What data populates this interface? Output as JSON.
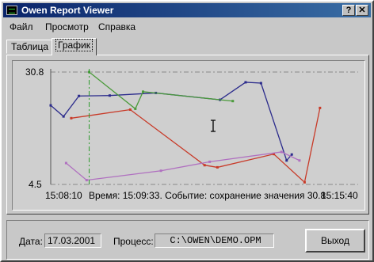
{
  "window": {
    "title": "Owen Report Viewer",
    "help_glyph": "?",
    "close_glyph": "✕"
  },
  "menu": [
    "Файл",
    "Просмотр",
    "Справка"
  ],
  "tabs": [
    {
      "label": "Таблица",
      "active": false
    },
    {
      "label": "График",
      "active": true
    }
  ],
  "chart": {
    "y_top_label": "30.8",
    "y_bottom_label": "4.5",
    "x_start_label": "15:08:10",
    "x_end_label": "15:15:40",
    "status_text": "Время: 15:09:33. Событие: сохранение значения 30.8"
  },
  "chart_data": {
    "type": "line",
    "x_range": [
      "15:08:10",
      "15:15:40"
    ],
    "ylim": [
      4.5,
      30.8
    ],
    "cursor": {
      "x": "15:09:33",
      "y": 30.8
    },
    "series": [
      {
        "color": "#2b2b8c",
        "points": [
          [
            0.0,
            23.0
          ],
          [
            0.05,
            20.4
          ],
          [
            0.11,
            25.2
          ],
          [
            0.23,
            25.3
          ],
          [
            0.41,
            25.9
          ],
          [
            0.66,
            24.3
          ],
          [
            0.76,
            28.4
          ],
          [
            0.82,
            28.2
          ],
          [
            0.92,
            10.1
          ],
          [
            0.94,
            11.5
          ]
        ]
      },
      {
        "color": "#4a9a3a",
        "points": [
          [
            0.15,
            30.8
          ],
          [
            0.33,
            22.2
          ],
          [
            0.36,
            26.2
          ],
          [
            0.71,
            24.0
          ]
        ]
      },
      {
        "color": "#c83a28",
        "points": [
          [
            0.08,
            20.0
          ],
          [
            0.31,
            22.0
          ],
          [
            0.6,
            9.0
          ],
          [
            0.65,
            8.5
          ],
          [
            0.87,
            11.6
          ],
          [
            0.99,
            5.0
          ],
          [
            1.05,
            22.4
          ]
        ]
      },
      {
        "color": "#b070c0",
        "points": [
          [
            0.06,
            9.5
          ],
          [
            0.14,
            5.5
          ],
          [
            0.43,
            7.7
          ],
          [
            0.62,
            9.8
          ],
          [
            0.9,
            12.1
          ],
          [
            0.97,
            10.1
          ]
        ]
      }
    ],
    "grid": true
  },
  "footer": {
    "date_label": "Дата:",
    "date_value": "17.03.2001",
    "process_label": "Процесс:",
    "process_value": "C:\\OWEN\\DEMO.OPM",
    "exit_label": "Выход"
  }
}
